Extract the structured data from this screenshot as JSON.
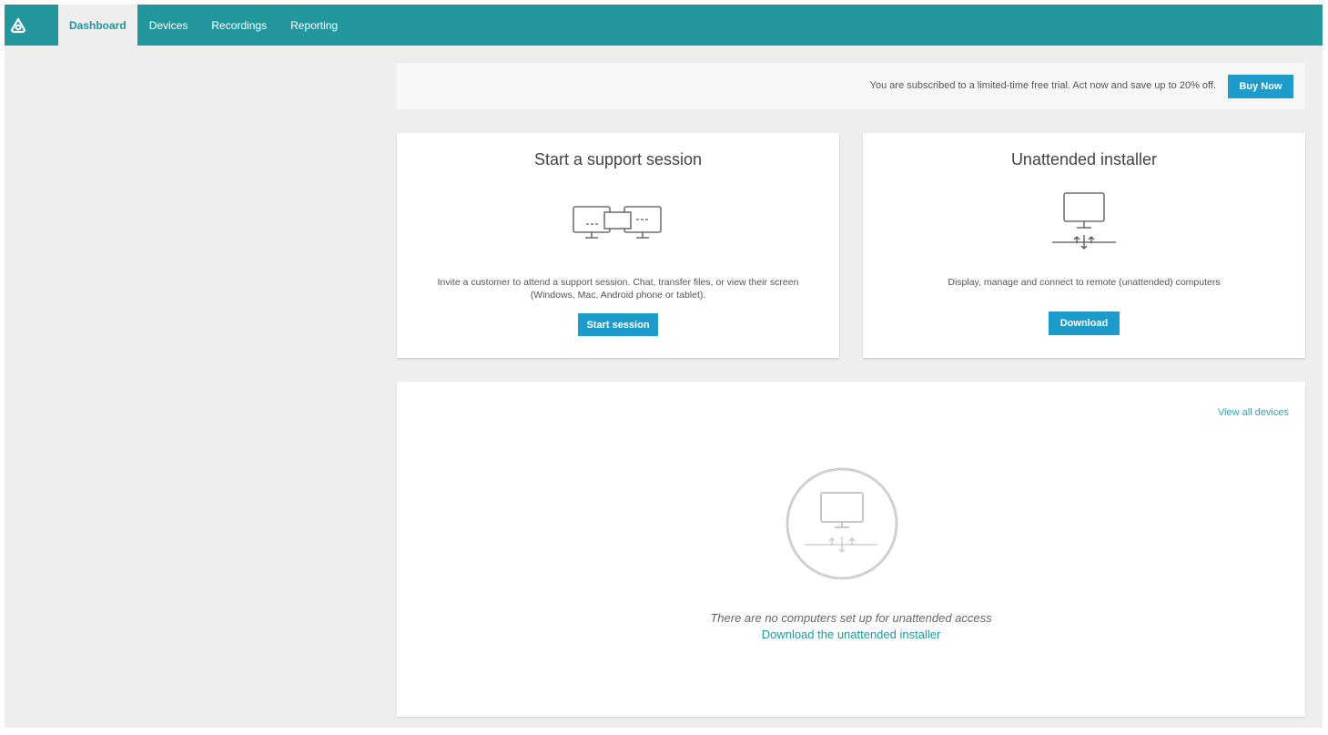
{
  "nav": {
    "logo_icon": "brand-logo-icon",
    "tabs": [
      {
        "label": "Dashboard",
        "active": true
      },
      {
        "label": "Devices",
        "active": false
      },
      {
        "label": "Recordings",
        "active": false
      },
      {
        "label": "Reporting",
        "active": false
      }
    ]
  },
  "banner": {
    "text": "You are subscribed to a limited-time free trial. Act now and save up to 20% off.",
    "button": "Buy Now"
  },
  "support_card": {
    "title": "Start a support session",
    "icon": "connected-computers-icon",
    "description": "Invite a customer to attend a support session. Chat, transfer files, or view their screen (Windows, Mac, Android phone or tablet).",
    "button": "Start session"
  },
  "installer_card": {
    "title": "Unattended installer",
    "icon": "network-computer-icon",
    "description": "Display, manage and connect to remote (unattended) computers",
    "button": "Download"
  },
  "devices_panel": {
    "view_all": "View all devices",
    "empty_icon": "network-computer-icon",
    "empty_text": "There are no computers set up for unattended access",
    "empty_link": "Download the unattended installer"
  },
  "colors": {
    "topbar": "#22979d",
    "button": "#1d9ccb",
    "background": "#eeeeee"
  }
}
